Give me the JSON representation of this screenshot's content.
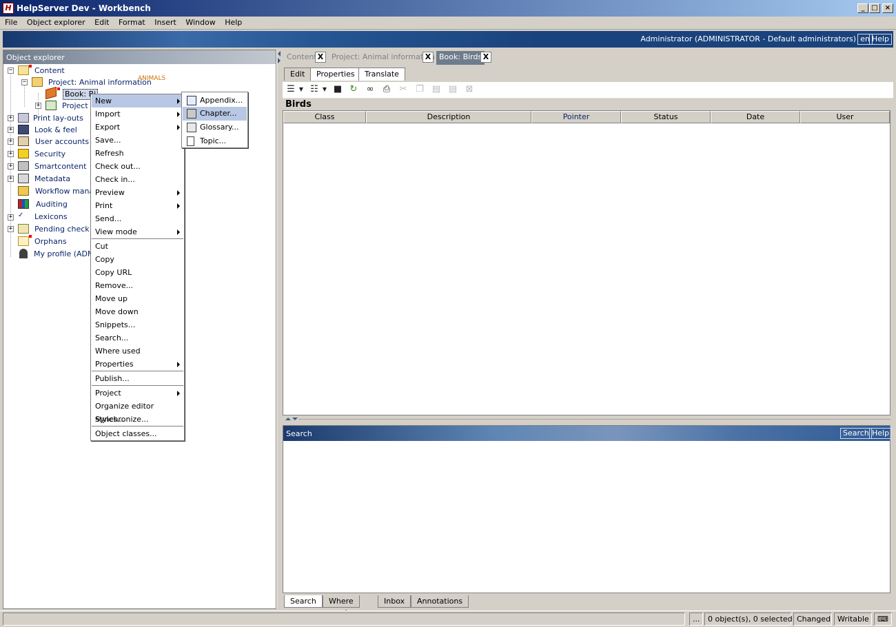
{
  "window": {
    "title": "HelpServer Dev - Workbench",
    "app_icon": "H",
    "buttons": {
      "minimize": "_",
      "maximize": "□",
      "close": "×"
    }
  },
  "menubar": [
    "File",
    "Object explorer",
    "Edit",
    "Format",
    "Insert",
    "Window",
    "Help"
  ],
  "banner": {
    "user": "Administrator (ADMINISTRATOR - Default administrators)",
    "lang": "en",
    "help": "Help"
  },
  "object_explorer": {
    "title": "Object explorer",
    "nodes": {
      "content": "Content",
      "project_animal": "Project: Animal information",
      "project_tag": "ANIMALS",
      "book_birds": "Book: Bi",
      "project_g": "Project g",
      "print_layouts": "Print lay-outs",
      "look_feel": "Look & feel",
      "user_accounts": "User accounts",
      "security": "Security",
      "smartcontent": "Smartcontent",
      "metadata": "Metadata",
      "workflow": "Workflow manag",
      "auditing": "Auditing",
      "lexicons": "Lexicons",
      "pending": "Pending check o",
      "orphans": "Orphans",
      "my_profile": "My profile (ADMIN"
    }
  },
  "doc_tabs": [
    {
      "label": "Content",
      "close": "X"
    },
    {
      "label": "Project: Animal information",
      "close": "X"
    },
    {
      "label": "Book: Birds",
      "close": "X"
    }
  ],
  "sub_tabs": [
    "Edit",
    "Properties",
    "Translate"
  ],
  "pane": {
    "title": "Birds",
    "columns": [
      "Class",
      "Description",
      "Pointer",
      "Status",
      "Date",
      "User"
    ]
  },
  "search_panel": {
    "title": "Search",
    "search_btn": "Search",
    "help_btn": "Help"
  },
  "bottom_tabs": [
    "Search",
    "Where used",
    "Inbox",
    "Annotations"
  ],
  "status": {
    "dots": "...",
    "selection": "0 object(s), 0 selected",
    "changed": "Changed",
    "writable": "Writable"
  },
  "context_menu": {
    "items": [
      "New",
      "Import",
      "Export",
      "Save...",
      "Refresh",
      "Check out...",
      "Check in...",
      "Preview",
      "Print",
      "Send...",
      "View mode",
      "Cut",
      "Copy",
      "Copy URL",
      "Remove...",
      "Move up",
      "Move down",
      "Snippets...",
      "Search...",
      "Where used",
      "Properties",
      "Publish...",
      "Project",
      "Organize editor styles...",
      "Synchronize...",
      "Object classes..."
    ],
    "submenu": [
      "Appendix...",
      "Chapter...",
      "Glossary...",
      "Topic..."
    ]
  }
}
